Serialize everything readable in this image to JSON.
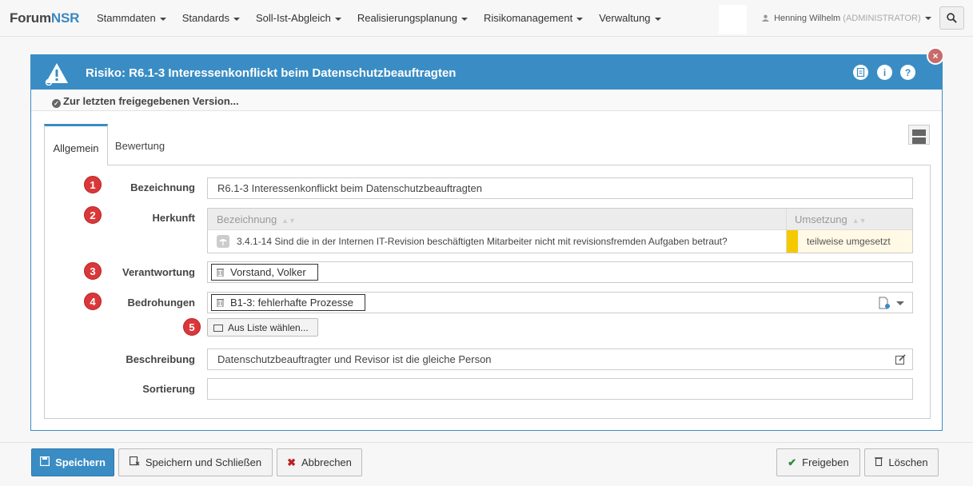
{
  "navbar": {
    "brand_a": "Forum",
    "brand_b": "NSR",
    "menu": [
      "Stammdaten",
      "Standards",
      "Soll-Ist-Abgleich",
      "Realisierungsplanung",
      "Risikomanagement",
      "Verwaltung"
    ],
    "user_name": "Henning Wilhelm",
    "user_role": "(ADMINISTRATOR)"
  },
  "dialog": {
    "title": "Risiko: R6.1-3 Interessenkonflickt beim Datenschutzbeauftragten",
    "header_icons": [
      "pdf-icon",
      "info-icon",
      "help-icon"
    ],
    "close_label": "×",
    "version_link": "Zur letzten freigegebenen Version..."
  },
  "tabs": [
    "Allgemein",
    "Bewertung"
  ],
  "form": {
    "badges": [
      "1",
      "2",
      "3",
      "4",
      "5"
    ],
    "bezeichnung_label": "Bezeichnung",
    "bezeichnung_value": "R6.1-3 Interessenkonflickt beim Datenschutzbeauftragten",
    "herkunft_label": "Herkunft",
    "herkunft_table": {
      "col_bezeichnung": "Bezeichnung",
      "col_umsetzung": "Umsetzung",
      "rows": [
        {
          "text": "3.4.1-14 Sind die in der Internen IT-Revision beschäftigten Mitarbeiter nicht mit revisionsfremden Aufgaben betraut?",
          "status": "teilweise umgesetzt",
          "status_color": "#f5c900"
        }
      ]
    },
    "verantwortung_label": "Verantwortung",
    "verantwortung_tag": "Vorstand, Volker",
    "bedrohungen_label": "Bedrohungen",
    "bedrohungen_tag": "B1-3: fehlerhafte Prozesse",
    "list_button": "Aus Liste wählen...",
    "beschreibung_label": "Beschreibung",
    "beschreibung_value": "Datenschutzbeauftragter und Revisor ist die gleiche Person",
    "sortierung_label": "Sortierung",
    "sortierung_value": ""
  },
  "footer": {
    "save": "Speichern",
    "save_close": "Speichern und Schließen",
    "cancel": "Abbrechen",
    "release": "Freigeben",
    "delete": "Löschen"
  },
  "colors": {
    "accent": "#3a8dc4",
    "danger_badge": "#d9383a",
    "status_partial": "#f5c900"
  }
}
